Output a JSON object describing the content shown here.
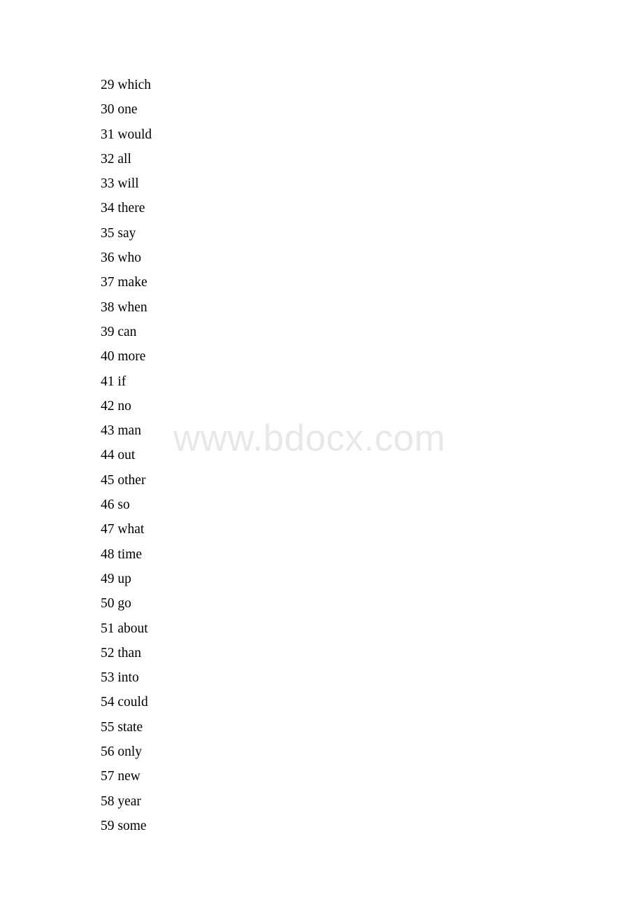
{
  "document": {
    "watermark_text": "www.bdocx.com",
    "watermark_color": "#e8e8e8",
    "text_color": "#000000",
    "background_color": "#ffffff"
  },
  "entries": [
    {
      "number": "29",
      "word": "which",
      "line": "29 which"
    },
    {
      "number": "30",
      "word": "one",
      "line": "30 one"
    },
    {
      "number": "31",
      "word": "would",
      "line": "31 would"
    },
    {
      "number": "32",
      "word": "all",
      "line": "32 all"
    },
    {
      "number": "33",
      "word": "will",
      "line": "33 will"
    },
    {
      "number": "34",
      "word": "there",
      "line": "34 there"
    },
    {
      "number": "35",
      "word": "say",
      "line": "35 say"
    },
    {
      "number": "36",
      "word": "who",
      "line": "36 who"
    },
    {
      "number": "37",
      "word": "make",
      "line": "37 make"
    },
    {
      "number": "38",
      "word": "when",
      "line": "38 when"
    },
    {
      "number": "39",
      "word": "can",
      "line": "39 can"
    },
    {
      "number": "40",
      "word": "more",
      "line": "40 more"
    },
    {
      "number": "41",
      "word": "if",
      "line": "41 if"
    },
    {
      "number": "42",
      "word": "no",
      "line": "42 no"
    },
    {
      "number": "43",
      "word": "man",
      "line": "43 man"
    },
    {
      "number": "44",
      "word": "out",
      "line": "44 out"
    },
    {
      "number": "45",
      "word": "other",
      "line": "45 other"
    },
    {
      "number": "46",
      "word": "so",
      "line": "46 so"
    },
    {
      "number": "47",
      "word": "what",
      "line": "47 what"
    },
    {
      "number": "48",
      "word": "time",
      "line": "48 time"
    },
    {
      "number": "49",
      "word": "up",
      "line": "49 up"
    },
    {
      "number": "50",
      "word": "go",
      "line": "50 go"
    },
    {
      "number": "51",
      "word": "about",
      "line": "51 about"
    },
    {
      "number": "52",
      "word": "than",
      "line": "52 than"
    },
    {
      "number": "53",
      "word": "into",
      "line": "53 into"
    },
    {
      "number": "54",
      "word": "could",
      "line": "54 could"
    },
    {
      "number": "55",
      "word": "state",
      "line": "55 state"
    },
    {
      "number": "56",
      "word": "only",
      "line": "56 only"
    },
    {
      "number": "57",
      "word": "new",
      "line": "57 new"
    },
    {
      "number": "58",
      "word": "year",
      "line": "58 year"
    },
    {
      "number": "59",
      "word": "some",
      "line": "59 some"
    }
  ]
}
